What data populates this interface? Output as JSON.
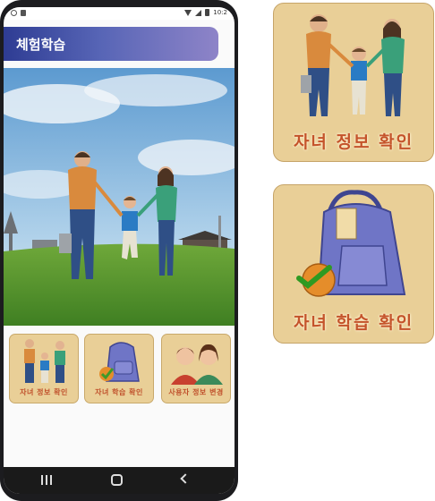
{
  "app": {
    "title": "체험학습"
  },
  "statusbar": {
    "time": "10:2"
  },
  "tiles": [
    {
      "label": "자녀 정보 확인"
    },
    {
      "label": "자녀 학습 확인"
    },
    {
      "label": "사용자 정보 변경"
    }
  ],
  "cards": [
    {
      "label": "자녀 정보 확인"
    },
    {
      "label": "자녀 학습 확인"
    }
  ],
  "colors": {
    "title_bar": "#3c4aa0",
    "tile_bg": "#e9cf97",
    "tile_text": "#c4532a",
    "nav_bg": "#1a1a1a"
  }
}
